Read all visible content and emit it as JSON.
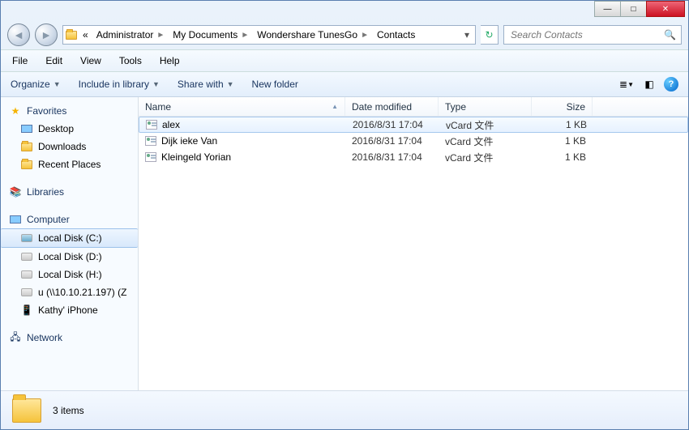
{
  "caption": {
    "min": "—",
    "max": "□",
    "close": "✕"
  },
  "nav": {
    "back": "◄",
    "forward": "►",
    "refresh": "↻",
    "dropdown": "▾"
  },
  "breadcrumbs": {
    "ellipsis": "«",
    "items": [
      "Administrator",
      "My Documents",
      "Wondershare TunesGo",
      "Contacts"
    ]
  },
  "search": {
    "placeholder": "Search Contacts"
  },
  "menu": {
    "file": "File",
    "edit": "Edit",
    "view": "View",
    "tools": "Tools",
    "help": "Help"
  },
  "toolbar": {
    "organize": "Organize",
    "include": "Include in library",
    "share": "Share with",
    "newfolder": "New folder"
  },
  "sidebar": {
    "favorites": {
      "label": "Favorites",
      "items": [
        "Desktop",
        "Downloads",
        "Recent Places"
      ]
    },
    "libraries": {
      "label": "Libraries"
    },
    "computer": {
      "label": "Computer",
      "items": [
        "Local Disk (C:)",
        "Local Disk (D:)",
        "Local Disk (H:)",
        "u (\\\\10.10.21.197) (Z",
        "Kathy' iPhone"
      ]
    },
    "network": {
      "label": "Network"
    }
  },
  "columns": {
    "name": "Name",
    "date": "Date modified",
    "type": "Type",
    "size": "Size"
  },
  "rows": [
    {
      "name": "alex",
      "date": "2016/8/31 17:04",
      "type": "vCard 文件",
      "size": "1 KB",
      "selected": true
    },
    {
      "name": "Dijk ieke Van",
      "date": "2016/8/31 17:04",
      "type": "vCard 文件",
      "size": "1 KB",
      "selected": false
    },
    {
      "name": "Kleingeld Yorian",
      "date": "2016/8/31 17:04",
      "type": "vCard 文件",
      "size": "1 KB",
      "selected": false
    }
  ],
  "status": {
    "count": "3 items"
  }
}
